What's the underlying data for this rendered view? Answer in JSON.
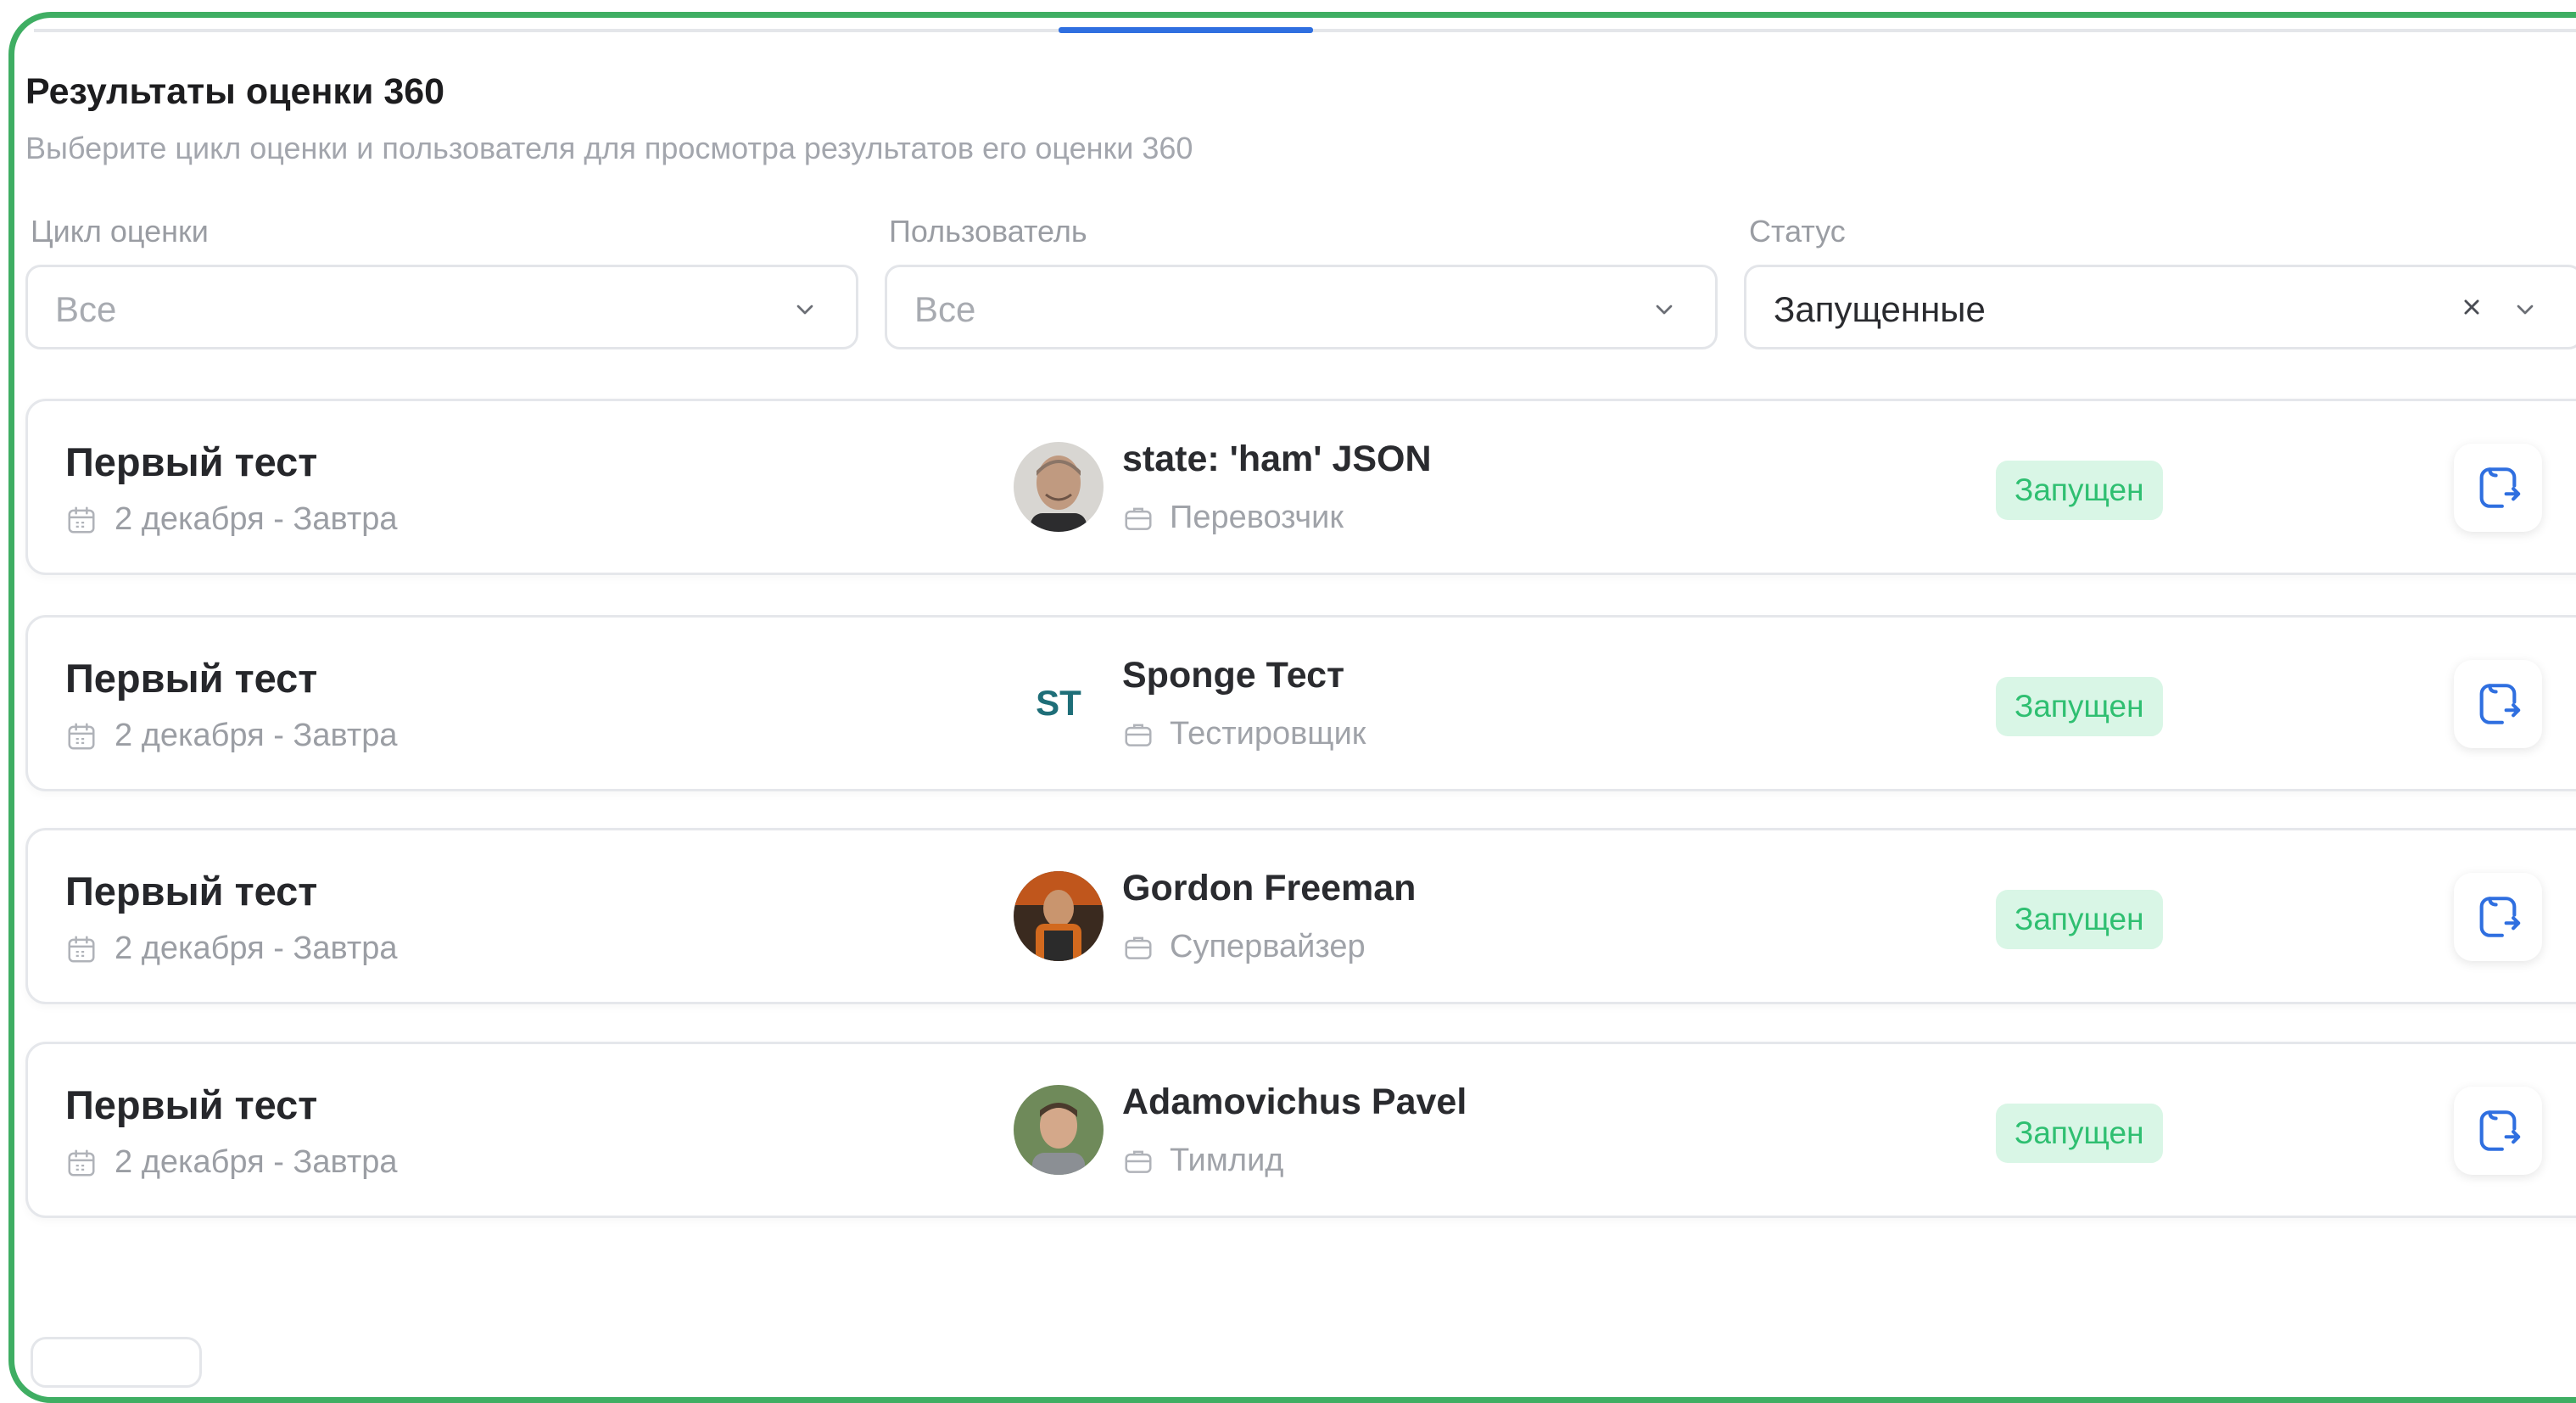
{
  "header": {
    "title": "Результаты оценки 360",
    "subtitle": "Выберите цикл оценки и пользователя для просмотра результатов его оценки 360"
  },
  "filters": {
    "cycle": {
      "label": "Цикл оценки",
      "value": "Все"
    },
    "user": {
      "label": "Пользователь",
      "value": "Все"
    },
    "status": {
      "label": "Статус",
      "value": "Запущенные"
    }
  },
  "results": [
    {
      "name": "Первый тест",
      "date": "2 декабря - Завтра",
      "user": "state: 'ham' JSON",
      "role": "Перевозчик",
      "initials": "",
      "status": "Запущен"
    },
    {
      "name": "Первый тест",
      "date": "2 декабря - Завтра",
      "user": "Sponge Тест",
      "role": "Тестировщик",
      "initials": "ST",
      "status": "Запущен"
    },
    {
      "name": "Первый тест",
      "date": "2 декабря - Завтра",
      "user": "Gordon Freeman",
      "role": "Супервайзер",
      "initials": "",
      "status": "Запущен"
    },
    {
      "name": "Первый тест",
      "date": "2 декабря - Завтра",
      "user": "Adamovichus Pavel",
      "role": "Тимлид",
      "initials": "",
      "status": "Запущен"
    }
  ],
  "icons": {
    "chevron": "chevron-down-icon",
    "clear": "close-icon",
    "date": "calendar-icon",
    "role": "briefcase-icon",
    "action": "open-results-icon"
  },
  "colors": {
    "accent": "#2f6fe0",
    "status_bg": "#d9f6e6",
    "status_text": "#2fbf71",
    "frame": "#3fae63"
  }
}
